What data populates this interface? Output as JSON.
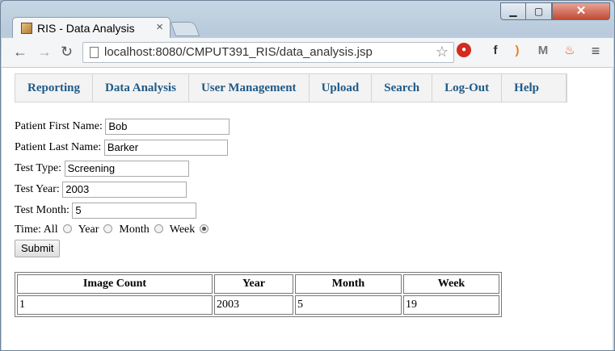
{
  "browser": {
    "tab_title": "RIS - Data Analysis",
    "tab_close": "×",
    "url": "localhost:8080/CMPUT391_RIS/data_analysis.jsp",
    "window_buttons": {
      "minimize": "▁",
      "maximize": "▢",
      "close": "✕"
    },
    "nav": {
      "back": "←",
      "forward": "→",
      "reload": "↻"
    },
    "star": "☆",
    "extensions": [
      "stop-icon",
      "f2-icon",
      "rss-icon",
      "gmail-icon",
      "fire-icon",
      "menu-icon"
    ],
    "extension_glyphs": [
      "●",
      "f",
      ")",
      "M",
      "♨",
      "≡"
    ]
  },
  "menu": {
    "items": [
      "Reporting",
      "Data Analysis",
      "User Management",
      "Upload",
      "Search",
      "Log-Out",
      "Help"
    ]
  },
  "form": {
    "first_name_label": "Patient First Name:",
    "first_name_value": "Bob",
    "last_name_label": "Patient Last Name:",
    "last_name_value": "Barker",
    "test_type_label": "Test Type:",
    "test_type_value": "Screening",
    "test_year_label": "Test Year:",
    "test_year_value": "2003",
    "test_month_label": "Test Month:",
    "test_month_value": "5",
    "time_label": "Time:",
    "time_options": [
      "All",
      "Year",
      "Month",
      "Week"
    ],
    "time_selected": "Week",
    "submit_label": "Submit"
  },
  "results": {
    "headers": [
      "Image Count",
      "Year",
      "Month",
      "Week"
    ],
    "rows": [
      [
        "1",
        "2003",
        "5",
        "19"
      ]
    ]
  },
  "colors": {
    "menu_link": "#1f5a87",
    "close_button": "#c24a34"
  }
}
